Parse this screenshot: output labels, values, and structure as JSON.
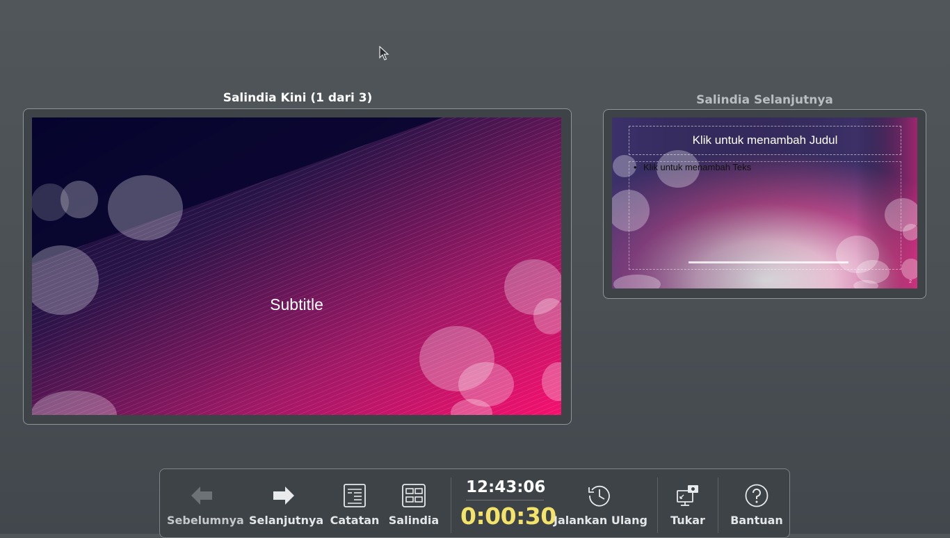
{
  "current_slide": {
    "heading": "Salindia Kini (1 dari 3)",
    "subtitle": "Subtitle"
  },
  "next_slide": {
    "heading": "Salindia Selanjutnya",
    "title_placeholder": "Klik untuk menambah Judul",
    "bullet": "•",
    "body_placeholder": "Klik untuk menambah Teks",
    "page_number": "2"
  },
  "toolbar": {
    "previous_label": "Sebelumnya",
    "next_label": "Selanjutnya",
    "notes_label": "Catatan",
    "slides_label": "Salindia",
    "clock": "12:43:06",
    "timer": "0:00:30",
    "restart_label": "Jalankan Ulang",
    "exchange_label": "Tukar",
    "help_label": "Bantuan"
  },
  "colors": {
    "background": "#4a5054",
    "timer": "#f4e36a",
    "slide_dark": "#06052e",
    "slide_pink": "#f0106e"
  },
  "icons": [
    "arrow-left-icon",
    "arrow-right-icon",
    "notes-icon",
    "slides-grid-icon",
    "restart-clock-icon",
    "exchange-screens-icon",
    "help-icon",
    "mouse-cursor-icon"
  ]
}
